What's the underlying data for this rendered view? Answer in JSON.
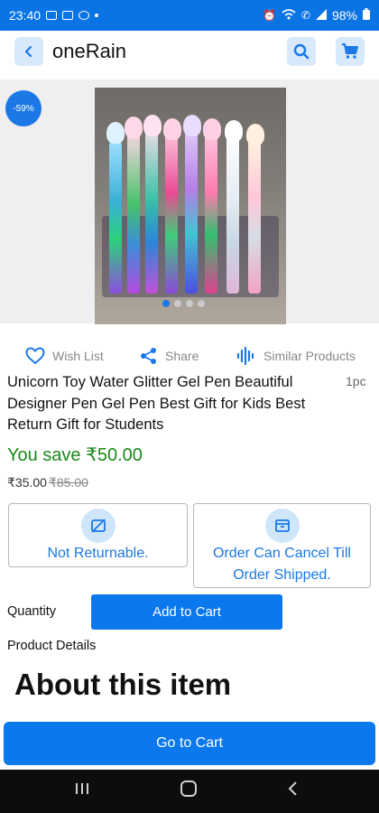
{
  "status_bar": {
    "time": "23:40",
    "battery": "98%"
  },
  "header": {
    "title": "oneRain",
    "icons": [
      "back-arrow-icon",
      "search-icon",
      "cart-icon"
    ]
  },
  "product": {
    "discount_badge": "-59%",
    "image_carousel": {
      "dot_count": 4,
      "active_index": 0
    },
    "title": "Unicorn Toy Water Glitter Gel Pen Beautiful Designer Pen Gel Pen Best Gift for Kids Best Return Gift for Students",
    "unit": "1pc",
    "you_save": "You save ₹50.00",
    "price": "₹35.00",
    "mrp": "₹85.00"
  },
  "actions": {
    "wishlist": "Wish List",
    "share": "Share",
    "similar": "Similar Products"
  },
  "policies": {
    "returnable": "Not Returnable.",
    "cancel": "Order Can Cancel Till Order Shipped."
  },
  "purchase": {
    "quantity_label": "Quantity",
    "add_to_cart": "Add to Cart"
  },
  "details": {
    "label": "Product Details",
    "about_heading": "About this item"
  },
  "footer": {
    "go_to_cart": "Go to Cart"
  },
  "colors": {
    "primary": "#0b78ee",
    "save_green": "#1a8a1a",
    "status_bar": "#0b74e5"
  }
}
